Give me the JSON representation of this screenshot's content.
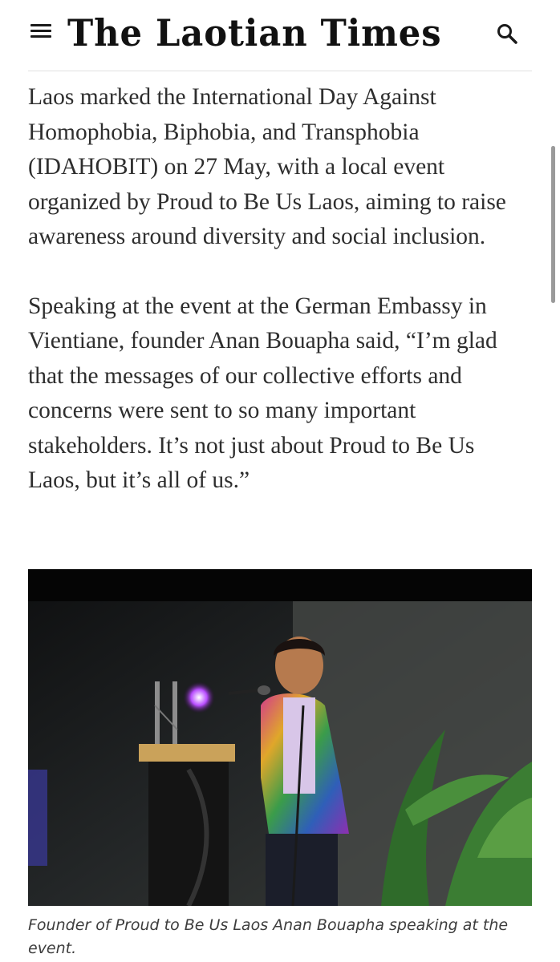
{
  "header": {
    "logo_text": "The Laotian Times",
    "menu_icon": "hamburger-menu-icon",
    "search_icon": "search-icon"
  },
  "article": {
    "paragraphs": [
      "Laos marked the International Day Against Homophobia, Biphobia, and Transphobia (IDAHOBIT) on 27 May, with a local event organized by Proud to Be Us Laos, aiming to raise awareness around diversity and social inclusion.",
      "Speaking at the event at the German Embassy in Vientiane, founder Anan Bouapha said, “I’m glad that the messages of our collective efforts and concerns were sent to so many important stakeholders. It’s not just about Proud to Be Us Laos, but it’s all of us.”"
    ],
    "caption": "Founder of Proud to Be Us Laos Anan Bouapha speaking at the event."
  },
  "colors": {
    "text": "#2e2e2e",
    "logo": "#111111",
    "rule": "#e0e0e0",
    "caption": "#3d3d3d"
  }
}
